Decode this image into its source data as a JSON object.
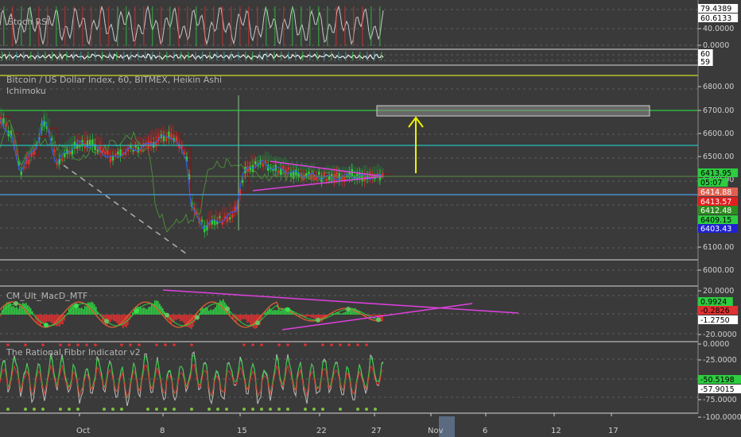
{
  "colors": {
    "background": "#3a3a3a",
    "separator": "#d8d8d8",
    "grid": "#6a6a6a",
    "bull": "#2ecc40",
    "bear": "#e03030",
    "trendline": "#e040e0",
    "arrow": "#f0f000",
    "level_green": "#2ecc40",
    "level_teal": "#20c0c0",
    "level_blue": "#4aa0e8",
    "level_yellow": "#d0e020",
    "target_box": "#9a9a9a"
  },
  "panes": {
    "stoch": {
      "title": "Stoch RSI",
      "ticks": [
        "40.0000",
        "0.0000"
      ],
      "labels": [
        {
          "text": "79.4389",
          "bg": "#ffffff",
          "fg": "#000000"
        },
        {
          "text": "60.6133",
          "bg": "#ffffff",
          "fg": "#000000"
        }
      ]
    },
    "mini": {
      "title": "",
      "labels": [
        {
          "text": "60",
          "bg": "#ffffff",
          "fg": "#000000"
        },
        {
          "text": "59",
          "bg": "#ffffff",
          "fg": "#000000"
        }
      ]
    },
    "price": {
      "title": "Bitcoin / US Dollar Index, 60, BITMEX, Heikin Ashi",
      "subtitle": "Ichimoku",
      "ticks": [
        "6800.00",
        "6700.00",
        "6600.00",
        "6500.00",
        "6400.00",
        "6300.00",
        "6200.00",
        "6100.00",
        "6000.00"
      ],
      "labels": [
        {
          "text": "6413.95",
          "bg": "#2ecc40",
          "fg": "#000000"
        },
        {
          "text": "05:07",
          "bg": "#2ecc40",
          "fg": "#000000"
        },
        {
          "text": "6414.88",
          "bg": "#e06050",
          "fg": "#ffffff"
        },
        {
          "text": "6413.57",
          "bg": "#e02020",
          "fg": "#ffffff"
        },
        {
          "text": "6412.48",
          "bg": "#2e8b20",
          "fg": "#ffffff"
        },
        {
          "text": "6409.15",
          "bg": "#2ecc40",
          "fg": "#000000"
        },
        {
          "text": "6403.43",
          "bg": "#2020d0",
          "fg": "#ffffff"
        }
      ]
    },
    "macd": {
      "title": "CM_Ult_MacD_MTF",
      "ticks": [
        "20.0000",
        "-20.0000"
      ],
      "labels": [
        {
          "text": "0.9924",
          "bg": "#2ecc40",
          "fg": "#000000"
        },
        {
          "text": "-0.2826",
          "bg": "#e03030",
          "fg": "#000000"
        },
        {
          "text": "-1.2750",
          "bg": "#ffffff",
          "fg": "#000000"
        }
      ]
    },
    "fibbr": {
      "title": "The Rational Fibbr Indicator v2",
      "ticks": [
        "0.0000",
        "-25.0000",
        "-75.0000",
        "-100.0000"
      ],
      "labels": [
        {
          "text": "-50.5198",
          "bg": "#2ecc40",
          "fg": "#000000"
        },
        {
          "text": "-57.9015",
          "bg": "#ffffff",
          "fg": "#000000"
        }
      ]
    }
  },
  "x_axis": {
    "ticks": [
      "Oct",
      "8",
      "15",
      "22",
      "27",
      "Nov",
      "6",
      "12",
      "17"
    ],
    "highlight": "Nov"
  },
  "chart_data": {
    "type": "line",
    "title": "Bitcoin / US Dollar Index, 60, BITMEX, Heikin Ashi",
    "indicators": [
      "Ichimoku",
      "Stoch RSI",
      "CM_Ult_MacD_MTF",
      "The Rational Fibbr Indicator v2"
    ],
    "x": [
      "Oct",
      "8",
      "15",
      "22",
      "27",
      "Nov",
      "6",
      "12",
      "17"
    ],
    "ylim": [
      6000,
      6850
    ],
    "levels": [
      6700,
      6550,
      6415,
      6380
    ],
    "target_zone": [
      6690,
      6720
    ],
    "last_price": 6413.95,
    "stoch_values": [
      79.4389,
      60.6133
    ],
    "macd_values": [
      0.9924,
      -0.2826,
      -1.275
    ],
    "fibbr_values": [
      -50.5198,
      -57.9015
    ]
  }
}
